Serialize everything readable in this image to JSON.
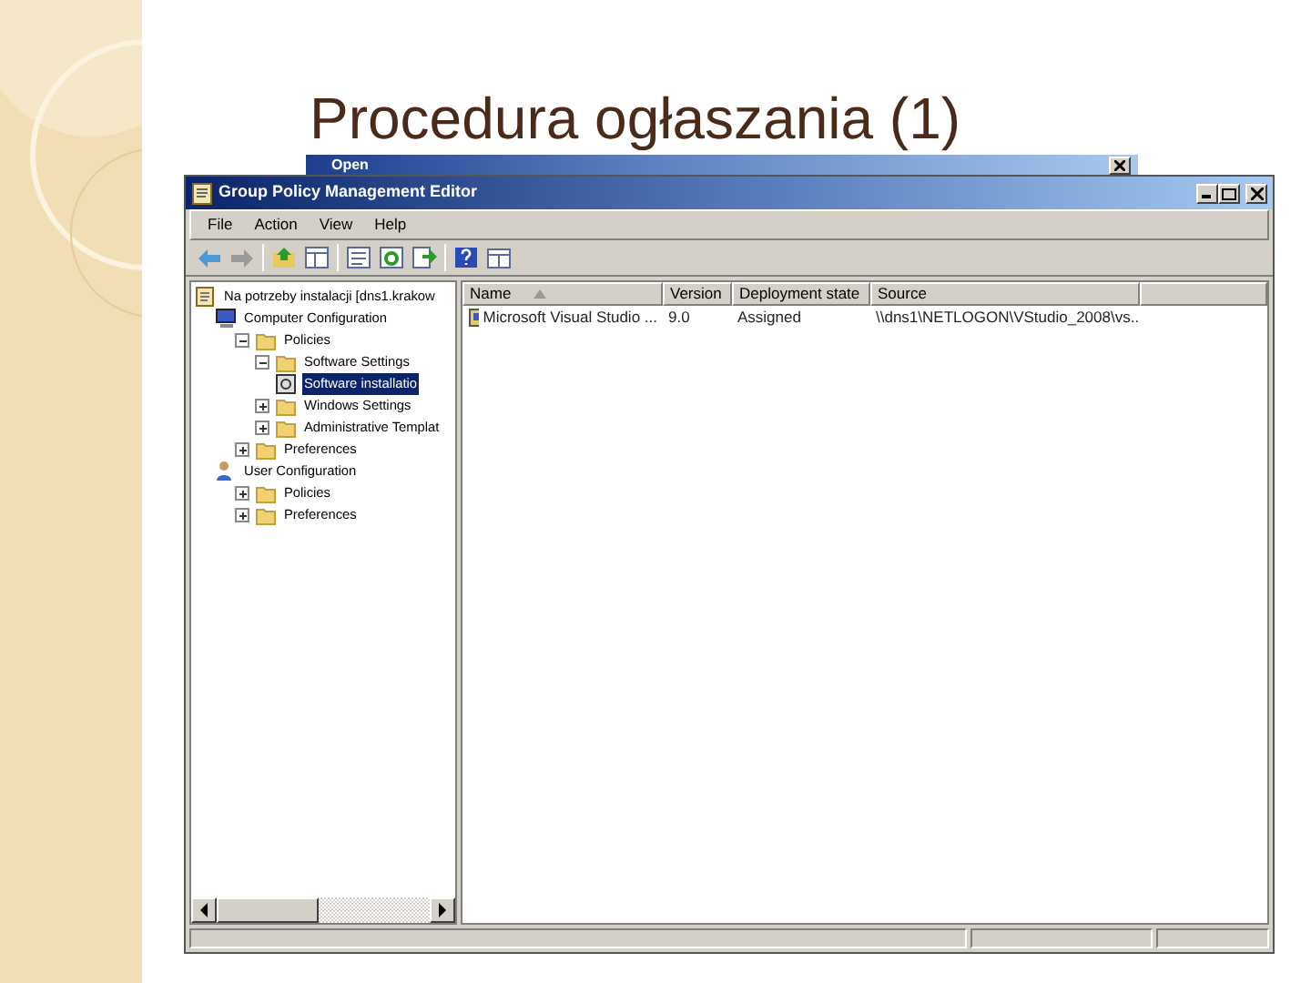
{
  "slide_title": "Procedura ogłaszania (1)",
  "back_window": {
    "title": "Open"
  },
  "window": {
    "title": "Group Policy Management Editor"
  },
  "menu": [
    "File",
    "Action",
    "View",
    "Help"
  ],
  "tree": [
    {
      "label": "Na potrzeby instalacji [dns1.krakow",
      "kind": "policy",
      "selected": false,
      "children": [
        {
          "label": "Computer Configuration",
          "kind": "computer",
          "selected": false,
          "children": [
            {
              "label": "Policies",
              "kind": "folder",
              "expanded": true,
              "selected": false,
              "children": [
                {
                  "label": "Software Settings",
                  "kind": "folder",
                  "expanded": true,
                  "selected": false,
                  "children": [
                    {
                      "label": "Software installatio",
                      "kind": "package",
                      "selected": true
                    }
                  ]
                },
                {
                  "label": "Windows Settings",
                  "kind": "folder",
                  "expanded": false,
                  "selected": false
                },
                {
                  "label": "Administrative Templat",
                  "kind": "folder",
                  "expanded": false,
                  "selected": false
                }
              ]
            },
            {
              "label": "Preferences",
              "kind": "folder",
              "expanded": false,
              "selected": false
            }
          ]
        },
        {
          "label": "User Configuration",
          "kind": "user",
          "selected": false,
          "children": [
            {
              "label": "Policies",
              "kind": "folder",
              "expanded": false,
              "selected": false
            },
            {
              "label": "Preferences",
              "kind": "folder",
              "expanded": false,
              "selected": false
            }
          ]
        }
      ]
    }
  ],
  "table": {
    "columns": [
      {
        "label": "Name",
        "kind": "sorted"
      },
      {
        "label": "Version",
        "kind": "plain"
      },
      {
        "label": "Deployment state",
        "kind": "plain"
      },
      {
        "label": "Source",
        "kind": "plain"
      }
    ],
    "rows": [
      [
        "Microsoft Visual Studio ...",
        "9.0",
        "Assigned",
        "\\\\dns1\\NETLOGON\\VStudio_2008\\vs..."
      ]
    ]
  }
}
